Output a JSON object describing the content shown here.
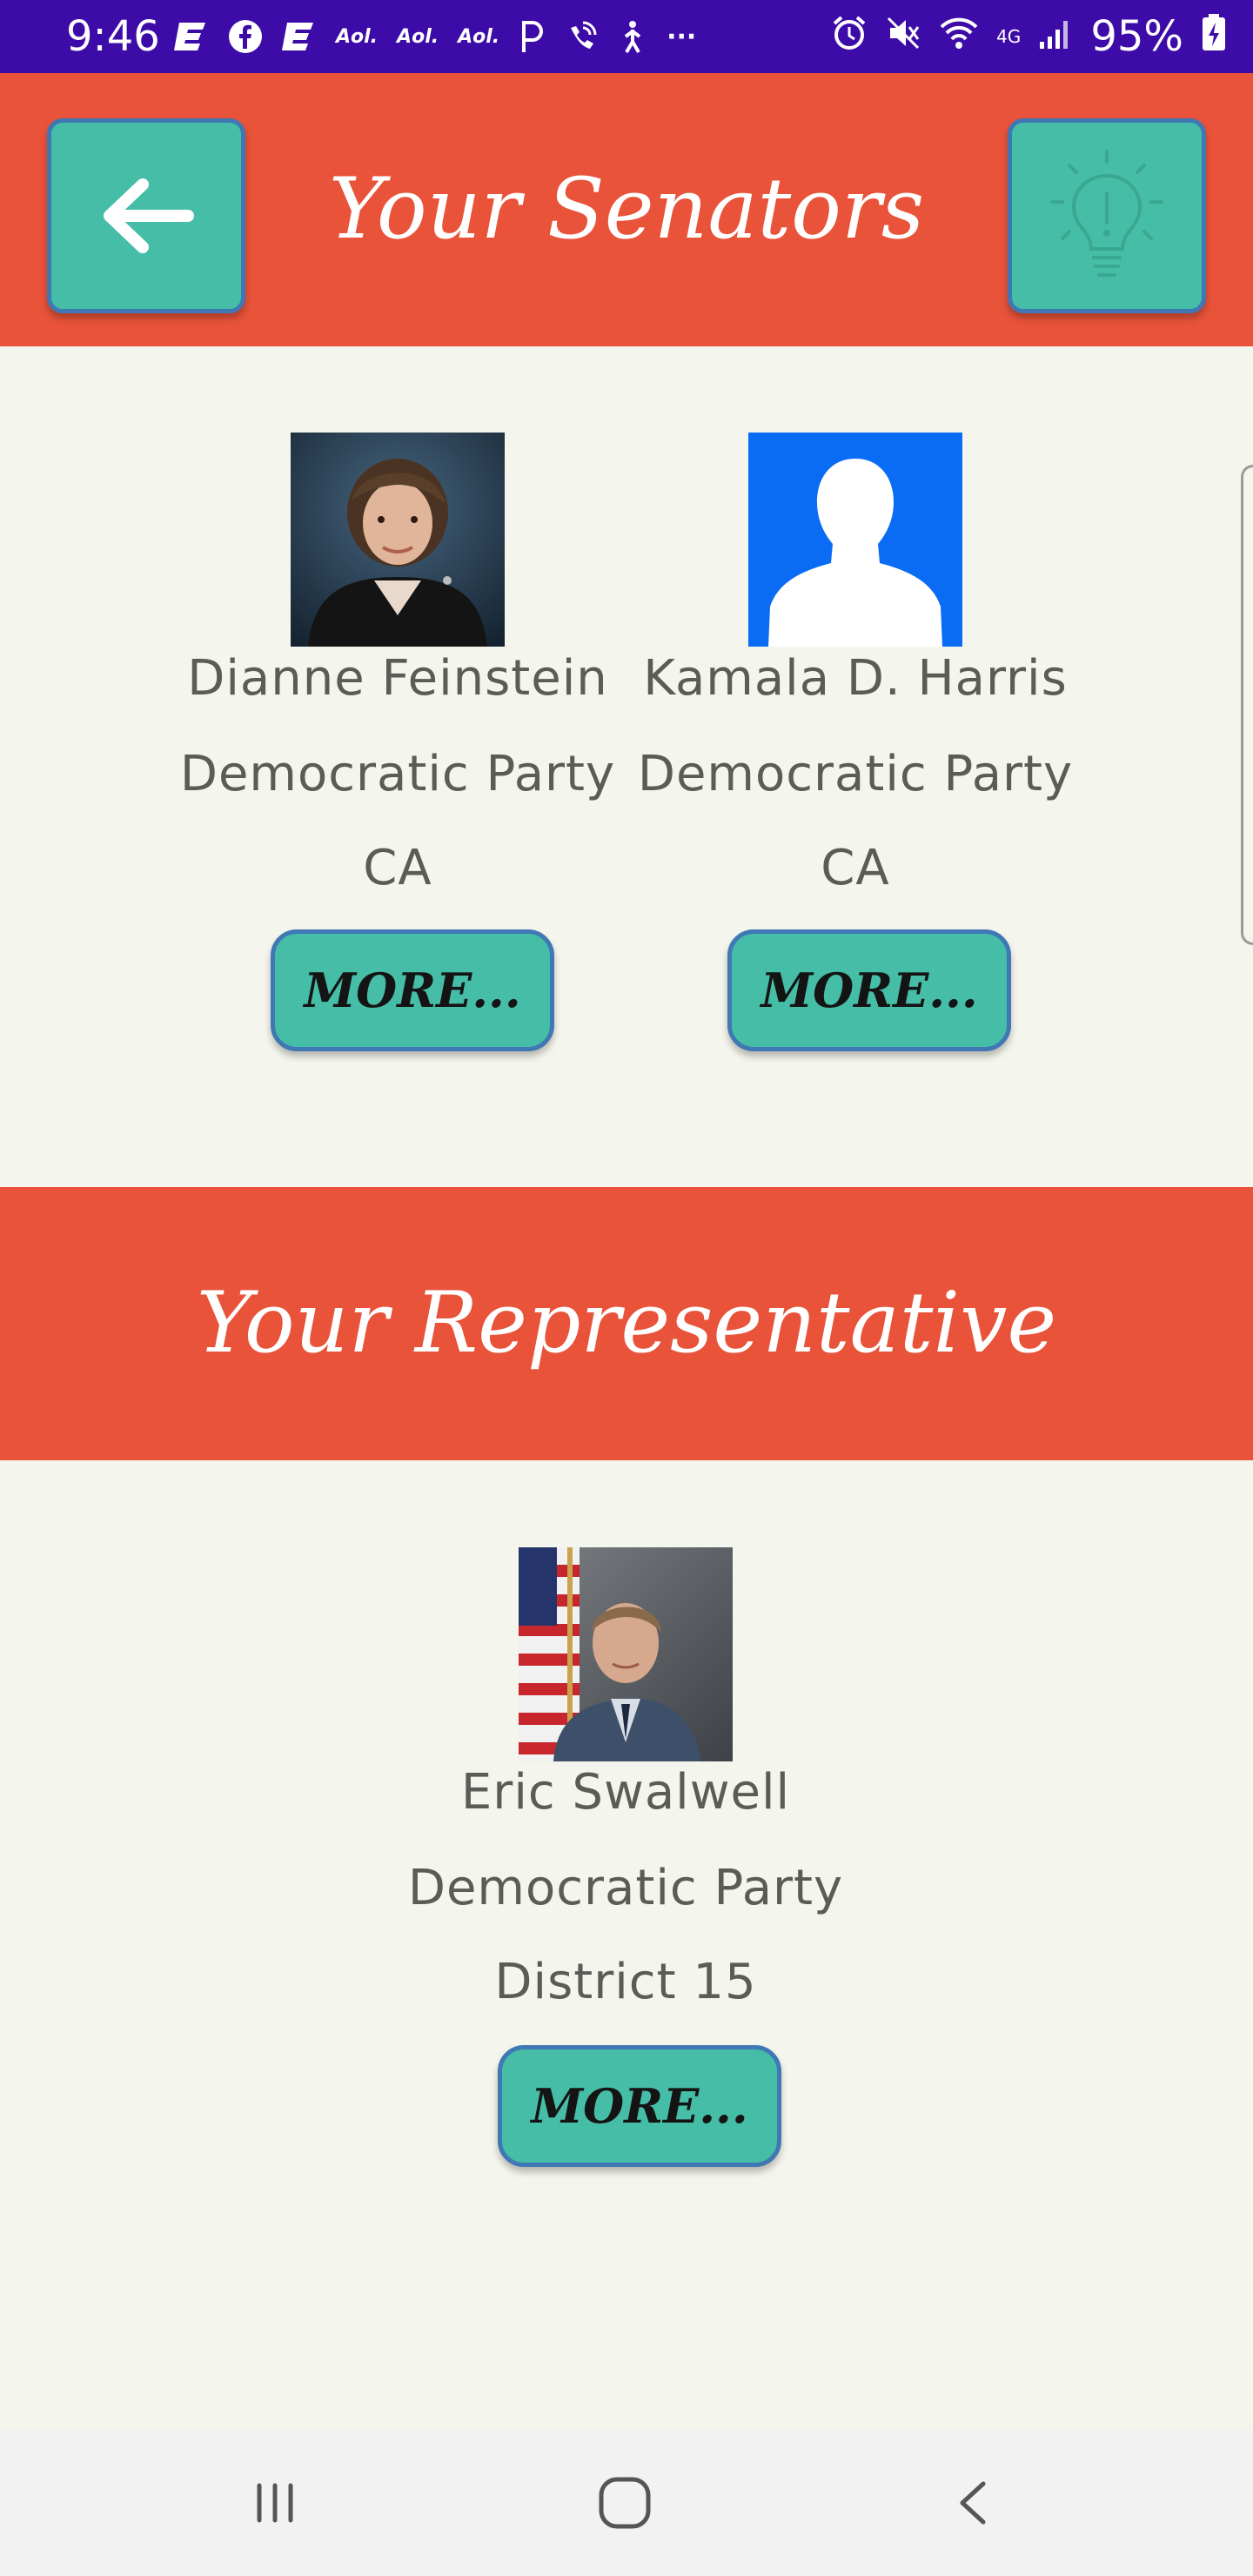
{
  "status_bar": {
    "time": "9:46",
    "notification_icons": [
      "e-icon",
      "facebook-icon",
      "e-icon",
      "aol-icon",
      "aol-icon",
      "aol-icon",
      "p-icon",
      "wifi-call-icon",
      "accessibility-icon",
      "more-dots-icon"
    ],
    "aol_label": "Aol.",
    "more_label": "···",
    "battery": "95%",
    "network": "4G"
  },
  "header": {
    "title": "Your Senators",
    "back_icon": "arrow-left-icon",
    "tip_icon": "lightbulb-icon"
  },
  "senators": [
    {
      "name": "Dianne Feinstein",
      "party": "Democratic Party",
      "location": "CA",
      "more_label": "MORE..."
    },
    {
      "name": "Kamala D. Harris",
      "party": "Democratic Party",
      "location": "CA",
      "more_label": "MORE..."
    }
  ],
  "representative_section": {
    "title": "Your Representative"
  },
  "representative": {
    "name": "Eric Swalwell",
    "party": "Democratic Party",
    "location": "District 15",
    "more_label": "MORE..."
  },
  "colors": {
    "status_bar": "#3d0ca8",
    "band": "#e8533a",
    "button": "#46bda6",
    "button_border": "#3f78b4",
    "background": "#f4f5ec",
    "text": "#5b5b58"
  }
}
